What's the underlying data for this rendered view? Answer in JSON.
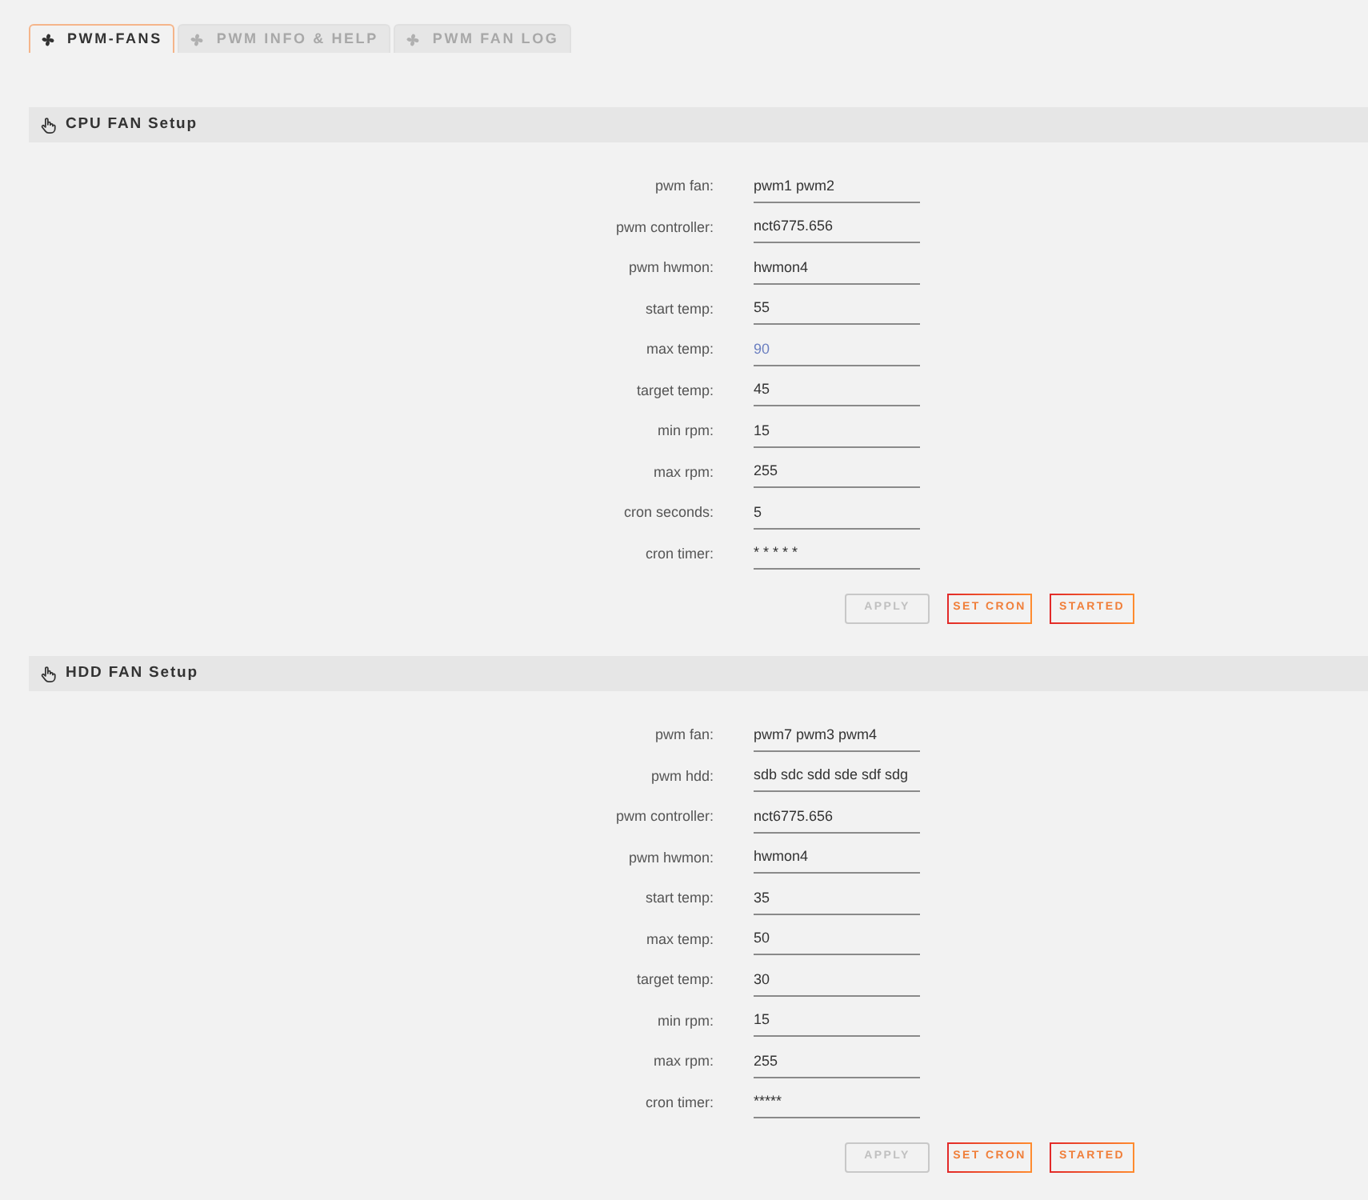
{
  "tabs": [
    {
      "label": "PWM-FANS",
      "selected": true
    },
    {
      "label": "PWM INFO & HELP",
      "selected": false
    },
    {
      "label": "PWM FAN LOG",
      "selected": false
    }
  ],
  "sections": [
    {
      "title": "CPU FAN Setup",
      "fields": [
        {
          "label": "pwm fan:",
          "value": "pwm1 pwm2",
          "highlighted": false
        },
        {
          "label": "pwm controller:",
          "value": "nct6775.656",
          "highlighted": false
        },
        {
          "label": "pwm hwmon:",
          "value": "hwmon4",
          "highlighted": false
        },
        {
          "label": "start temp:",
          "value": "55",
          "highlighted": false
        },
        {
          "label": "max temp:",
          "value": "90",
          "highlighted": true
        },
        {
          "label": "target temp:",
          "value": "45",
          "highlighted": false
        },
        {
          "label": "min rpm:",
          "value": "15",
          "highlighted": false
        },
        {
          "label": "max rpm:",
          "value": "255",
          "highlighted": false
        },
        {
          "label": "cron seconds:",
          "value": "5",
          "highlighted": false
        },
        {
          "label": "cron timer:",
          "value": "* * * * *",
          "highlighted": false
        }
      ],
      "buttons": [
        {
          "label": "APPLY",
          "disabled": true
        },
        {
          "label": "SET CRON",
          "disabled": false
        },
        {
          "label": "STARTED",
          "disabled": false
        }
      ]
    },
    {
      "title": "HDD FAN Setup",
      "fields": [
        {
          "label": "pwm fan:",
          "value": "pwm7 pwm3 pwm4",
          "highlighted": false
        },
        {
          "label": "pwm hdd:",
          "value": "sdb sdc sdd sde sdf sdg",
          "highlighted": false
        },
        {
          "label": "pwm controller:",
          "value": "nct6775.656",
          "highlighted": false
        },
        {
          "label": "pwm hwmon:",
          "value": "hwmon4",
          "highlighted": false
        },
        {
          "label": "start temp:",
          "value": "35",
          "highlighted": false
        },
        {
          "label": "max temp:",
          "value": "50",
          "highlighted": false
        },
        {
          "label": "target temp:",
          "value": "30",
          "highlighted": false
        },
        {
          "label": "min rpm:",
          "value": "15",
          "highlighted": false
        },
        {
          "label": "max rpm:",
          "value": "255",
          "highlighted": false
        },
        {
          "label": "cron timer:",
          "value": "*****",
          "highlighted": false
        }
      ],
      "buttons": [
        {
          "label": "APPLY",
          "disabled": true
        },
        {
          "label": "SET CRON",
          "disabled": false
        },
        {
          "label": "STARTED",
          "disabled": false
        }
      ]
    }
  ]
}
